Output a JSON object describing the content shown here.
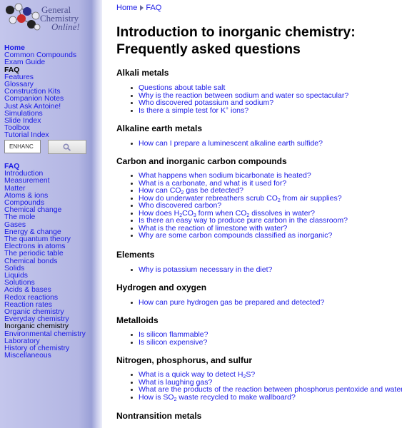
{
  "logo": {
    "line1": "General",
    "line2": "Chemistry",
    "line3": "Online!"
  },
  "nav_main": [
    {
      "label": "Home",
      "bold": true
    },
    {
      "label": "Common Compounds"
    },
    {
      "label": "Exam Guide"
    },
    {
      "label": "FAQ",
      "bold": true,
      "current": true
    },
    {
      "label": "Features"
    },
    {
      "label": "Glossary"
    },
    {
      "label": "Construction Kits"
    },
    {
      "label": "Companion Notes"
    },
    {
      "label": "Just Ask Antoine!"
    },
    {
      "label": "Simulations"
    },
    {
      "label": "Slide Index"
    },
    {
      "label": "Toolbox"
    },
    {
      "label": "Tutorial Index"
    }
  ],
  "search": {
    "value": "ENHANC"
  },
  "nav_faq": [
    {
      "label": "FAQ",
      "bold": true
    },
    {
      "label": "Introduction"
    },
    {
      "label": "Measurement"
    },
    {
      "label": "Matter"
    },
    {
      "label": "Atoms & ions"
    },
    {
      "label": "Compounds"
    },
    {
      "label": "Chemical change"
    },
    {
      "label": "The mole"
    },
    {
      "label": "Gases"
    },
    {
      "label": "Energy & change"
    },
    {
      "label": "The quantum theory"
    },
    {
      "label": "Electrons in atoms"
    },
    {
      "label": "The periodic table"
    },
    {
      "label": "Chemical bonds"
    },
    {
      "label": "Solids"
    },
    {
      "label": "Liquids"
    },
    {
      "label": "Solutions"
    },
    {
      "label": "Acids & bases"
    },
    {
      "label": "Redox reactions"
    },
    {
      "label": "Reaction rates"
    },
    {
      "label": "Organic chemistry"
    },
    {
      "label": "Everyday chemistry"
    },
    {
      "label": "Inorganic chemistry",
      "current": true
    },
    {
      "label": "Environmental chemistry"
    },
    {
      "label": "Laboratory"
    },
    {
      "label": "History of chemistry"
    },
    {
      "label": "Miscellaneous"
    }
  ],
  "breadcrumb": {
    "home": "Home",
    "faq": "FAQ"
  },
  "title": "Introduction to inorganic chemistry: Frequently asked questions",
  "sections": [
    {
      "heading": "Alkali metals",
      "questions": [
        {
          "parts": [
            "Questions about table salt"
          ]
        },
        {
          "parts": [
            "Why is the reaction between sodium and water so spectacular?"
          ]
        },
        {
          "parts": [
            "Who discovered potassium and sodium?"
          ]
        },
        {
          "parts": [
            "Is there a simple test for K",
            {
              "sup": "+"
            },
            " ions?"
          ]
        }
      ]
    },
    {
      "heading": "Alkaline earth metals",
      "questions": [
        {
          "parts": [
            "How can I prepare a luminescent alkaline earth sulfide?"
          ]
        }
      ]
    },
    {
      "heading": "Carbon and inorganic carbon compounds",
      "questions": [
        {
          "parts": [
            "What happens when sodium bicarbonate is heated?"
          ]
        },
        {
          "parts": [
            "What is a carbonate, and what is it used for?"
          ]
        },
        {
          "parts": [
            "How can CO",
            {
              "sub": "2"
            },
            " gas be detected?"
          ]
        },
        {
          "parts": [
            "How do underwater rebreathers scrub CO",
            {
              "sub": "2"
            },
            " from air supplies?"
          ]
        },
        {
          "parts": [
            "Who discovered carbon?"
          ]
        },
        {
          "parts": [
            "How does H",
            {
              "sub": "2"
            },
            "CO",
            {
              "sub": "3"
            },
            " form when CO",
            {
              "sub": "2"
            },
            " dissolves in water?"
          ]
        },
        {
          "parts": [
            "Is there an easy way to produce pure carbon in the classroom?"
          ]
        },
        {
          "parts": [
            "What is the reaction of limestone with water?"
          ]
        },
        {
          "parts": [
            "Why are some carbon compounds classified as inorganic?"
          ]
        }
      ]
    },
    {
      "heading": "Elements",
      "questions": [
        {
          "parts": [
            "Why is potassium necessary in the diet?"
          ]
        }
      ]
    },
    {
      "heading": "Hydrogen and oxygen",
      "questions": [
        {
          "parts": [
            "How can pure hydrogen gas be prepared and detected?"
          ]
        }
      ]
    },
    {
      "heading": "Metalloids",
      "questions": [
        {
          "parts": [
            "Is silicon flammable?"
          ]
        },
        {
          "parts": [
            "Is silicon expensive?"
          ]
        }
      ]
    },
    {
      "heading": "Nitrogen, phosphorus, and sulfur",
      "questions": [
        {
          "parts": [
            "What is a quick way to detect H",
            {
              "sub": "2"
            },
            "S?"
          ]
        },
        {
          "parts": [
            "What is laughing gas?"
          ]
        },
        {
          "parts": [
            "What are the products of the reaction between phosphorus pentoxide and water?"
          ]
        },
        {
          "parts": [
            "How is SO",
            {
              "sub": "2"
            },
            " waste recycled to make wallboard?"
          ]
        }
      ]
    },
    {
      "heading": "Nontransition metals",
      "questions": []
    }
  ],
  "colors": {
    "link": "#1a1ae6",
    "sidebar": "#b3b6e3",
    "logo_text": "#4b4d8c"
  },
  "icons": {
    "search": "magnifier-icon",
    "breadcrumb_separator": "triangle-right-icon",
    "bullet": "disc-bullet-icon"
  }
}
